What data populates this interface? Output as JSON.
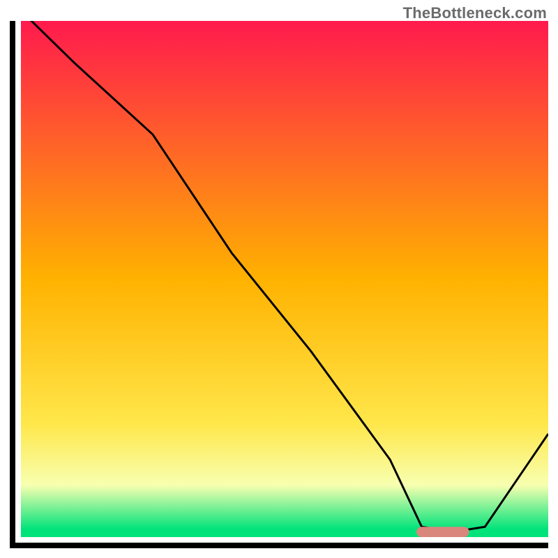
{
  "watermark": "TheBottleneck.com",
  "chart_data": {
    "type": "line",
    "title": "",
    "xlabel": "",
    "ylabel": "",
    "xlim": [
      0,
      100
    ],
    "ylim": [
      0,
      100
    ],
    "grid": false,
    "gradient_stops": [
      {
        "offset": 0.0,
        "color": "#ff1a4d"
      },
      {
        "offset": 0.5,
        "color": "#ffb200"
      },
      {
        "offset": 0.78,
        "color": "#ffe74a"
      },
      {
        "offset": 0.9,
        "color": "#f7ffb0"
      },
      {
        "offset": 0.985,
        "color": "#00e37a"
      },
      {
        "offset": 1.0,
        "color": "#00e37a"
      }
    ],
    "series": [
      {
        "name": "bottleneck-curve",
        "color": "#000000",
        "x": [
          0,
          10,
          25,
          40,
          55,
          70,
          76,
          82,
          88,
          100
        ],
        "y": [
          102,
          92,
          78,
          55,
          36,
          15,
          2,
          1,
          2,
          20
        ]
      }
    ],
    "marker": {
      "name": "optimal-range",
      "color": "#d9867d",
      "x_start": 75,
      "x_end": 85,
      "y": 1,
      "thickness": 2
    }
  }
}
